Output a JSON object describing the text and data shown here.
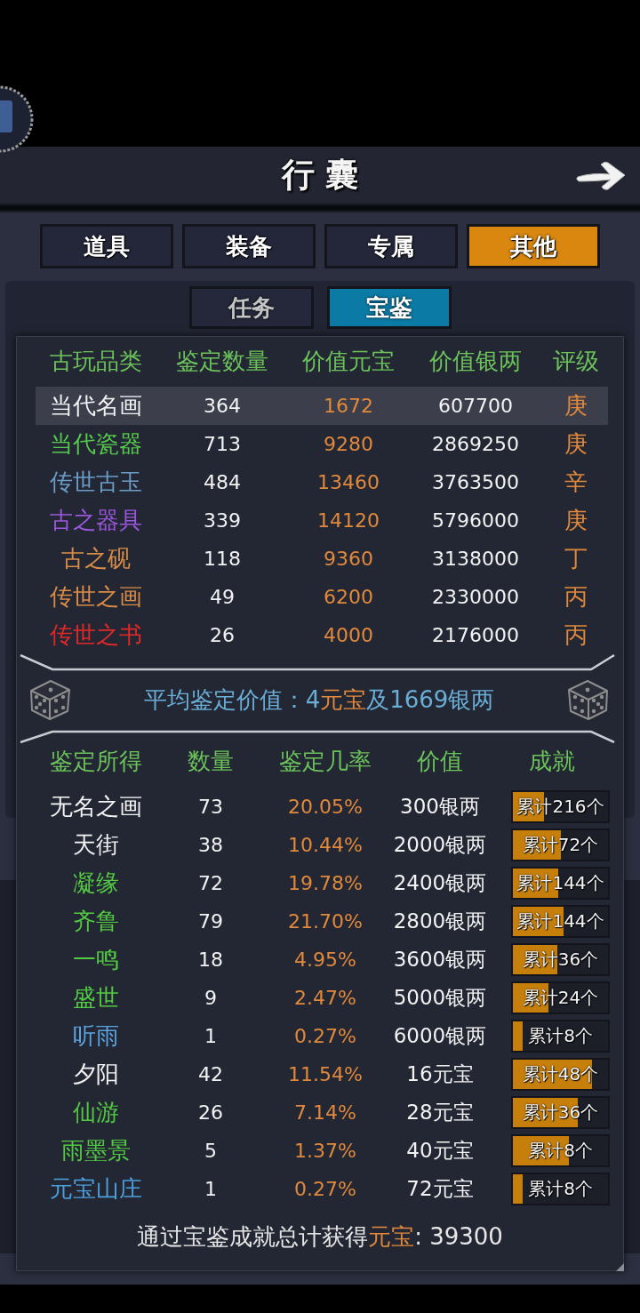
{
  "header": {
    "title": "行 囊"
  },
  "tabs": [
    {
      "label": "道具",
      "selected": false
    },
    {
      "label": "装备",
      "selected": false
    },
    {
      "label": "专属",
      "selected": false
    },
    {
      "label": "其他",
      "selected": true
    }
  ],
  "subtabs": [
    {
      "label": "任务",
      "selected": false
    },
    {
      "label": "宝鉴",
      "selected": true
    }
  ],
  "antiques_table": {
    "columns": [
      "古玩品类",
      "鉴定数量",
      "价值元宝",
      "价值银两",
      "评级"
    ],
    "rows": [
      {
        "category": "当代名画",
        "color": "#f2f2f2",
        "count": "364",
        "ingots": "1672",
        "taels": "607700",
        "grade": "庚",
        "selected": true
      },
      {
        "category": "当代瓷器",
        "color": "#55c94b",
        "count": "713",
        "ingots": "9280",
        "taels": "2869250",
        "grade": "庚",
        "selected": false
      },
      {
        "category": "传世古玉",
        "color": "#6a9cc6",
        "count": "484",
        "ingots": "13460",
        "taels": "3763500",
        "grade": "辛",
        "selected": false
      },
      {
        "category": "古之器具",
        "color": "#9a56dc",
        "count": "339",
        "ingots": "14120",
        "taels": "5796000",
        "grade": "庚",
        "selected": false
      },
      {
        "category": "古之砚",
        "color": "#d98c46",
        "count": "118",
        "ingots": "9360",
        "taels": "3138000",
        "grade": "丁",
        "selected": false
      },
      {
        "category": "传世之画",
        "color": "#d98c46",
        "count": "49",
        "ingots": "6200",
        "taels": "2330000",
        "grade": "丙",
        "selected": false
      },
      {
        "category": "传世之书",
        "color": "#e02828",
        "count": "26",
        "ingots": "4000",
        "taels": "2176000",
        "grade": "丙",
        "selected": false
      }
    ]
  },
  "average_value": {
    "segments": [
      {
        "text": "平均鉴定价值：4",
        "kind": "plain"
      },
      {
        "text": "元宝",
        "kind": "currency"
      },
      {
        "text": "及1669银两",
        "kind": "plain"
      }
    ]
  },
  "results_table": {
    "columns": [
      "鉴定所得",
      "数量",
      "鉴定几率",
      "价值",
      "成就"
    ],
    "rows": [
      {
        "name": "无名之画",
        "color": "#f2f2f2",
        "count": "73",
        "rate": "20.05%",
        "value": "300银两",
        "achievement": "累计216个",
        "level": 0.33
      },
      {
        "name": "天街",
        "color": "#f2f2f2",
        "count": "38",
        "rate": "10.44%",
        "value": "2000银两",
        "achievement": "累计72个",
        "level": 0.5
      },
      {
        "name": "凝缘",
        "color": "#52c843",
        "count": "72",
        "rate": "19.78%",
        "value": "2400银两",
        "achievement": "累计144个",
        "level": 0.48
      },
      {
        "name": "齐鲁",
        "color": "#52c843",
        "count": "79",
        "rate": "21.70%",
        "value": "2800银两",
        "achievement": "累计144个",
        "level": 0.53
      },
      {
        "name": "一鸣",
        "color": "#52c843",
        "count": "18",
        "rate": "4.95%",
        "value": "3600银两",
        "achievement": "累计36个",
        "level": 0.47
      },
      {
        "name": "盛世",
        "color": "#52c843",
        "count": "9",
        "rate": "2.47%",
        "value": "5000银两",
        "achievement": "累计24个",
        "level": 0.37
      },
      {
        "name": "听雨",
        "color": "#5ba3de",
        "count": "1",
        "rate": "0.27%",
        "value": "6000银两",
        "achievement": "累计8个",
        "level": 0.1
      },
      {
        "name": "夕阳",
        "color": "#f2f2f2",
        "count": "42",
        "rate": "11.54%",
        "value": "16元宝",
        "achievement": "累计48个",
        "level": 0.83
      },
      {
        "name": "仙游",
        "color": "#52c843",
        "count": "26",
        "rate": "7.14%",
        "value": "28元宝",
        "achievement": "累计36个",
        "level": 0.68
      },
      {
        "name": "雨墨景",
        "color": "#52c843",
        "count": "5",
        "rate": "1.37%",
        "value": "40元宝",
        "achievement": "累计8个",
        "level": 0.59
      },
      {
        "name": "元宝山庄",
        "color": "#4c9fdd",
        "count": "1",
        "rate": "0.27%",
        "value": "72元宝",
        "achievement": "累计8个",
        "level": 0.1
      }
    ]
  },
  "total": {
    "segments": [
      {
        "text": "通过宝鉴成就总计获得",
        "kind": "plain"
      },
      {
        "text": "元宝",
        "kind": "currency"
      },
      {
        "text": ": 39300",
        "kind": "plain"
      }
    ]
  }
}
